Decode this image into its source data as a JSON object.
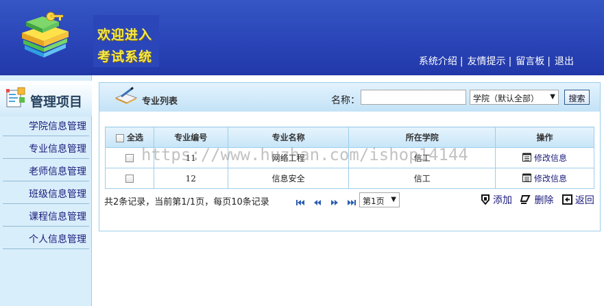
{
  "header": {
    "logo_line1": "欢迎进入",
    "logo_line2": "考试系统",
    "nav": [
      "系统介绍",
      "友情提示",
      "留言板",
      "退出"
    ]
  },
  "sidebar": {
    "title": "管理项目",
    "items": [
      {
        "label": "学院信息管理"
      },
      {
        "label": "专业信息管理"
      },
      {
        "label": "老师信息管理"
      },
      {
        "label": "班级信息管理"
      },
      {
        "label": "课程信息管理"
      },
      {
        "label": "个人信息管理"
      }
    ]
  },
  "panel": {
    "title": "专业列表",
    "search": {
      "name_label": "名称：",
      "name_value": "",
      "college_selected": "学院（默认全部）",
      "search_button": "搜索"
    },
    "table": {
      "select_all": "全选",
      "columns": [
        "专业编号",
        "专业名称",
        "所在学院",
        "操作"
      ],
      "rows": [
        {
          "id": "11",
          "name": "网络工程",
          "college": "信工",
          "action": "修改信息"
        },
        {
          "id": "12",
          "name": "信息安全",
          "college": "信工",
          "action": "修改信息"
        }
      ]
    },
    "summary": "共2条记录，当前第1/1页，每页10条记录",
    "page_selected": "第1页",
    "actions": {
      "add": "添加",
      "delete": "删除",
      "back": "返回"
    }
  },
  "watermark": "https://www.huzhan.com/ishop14144",
  "colors": {
    "header": "#2a45b8",
    "sidebar": "#d9eefb",
    "border": "#9ccde9",
    "logo_text": "#f4e94a"
  }
}
